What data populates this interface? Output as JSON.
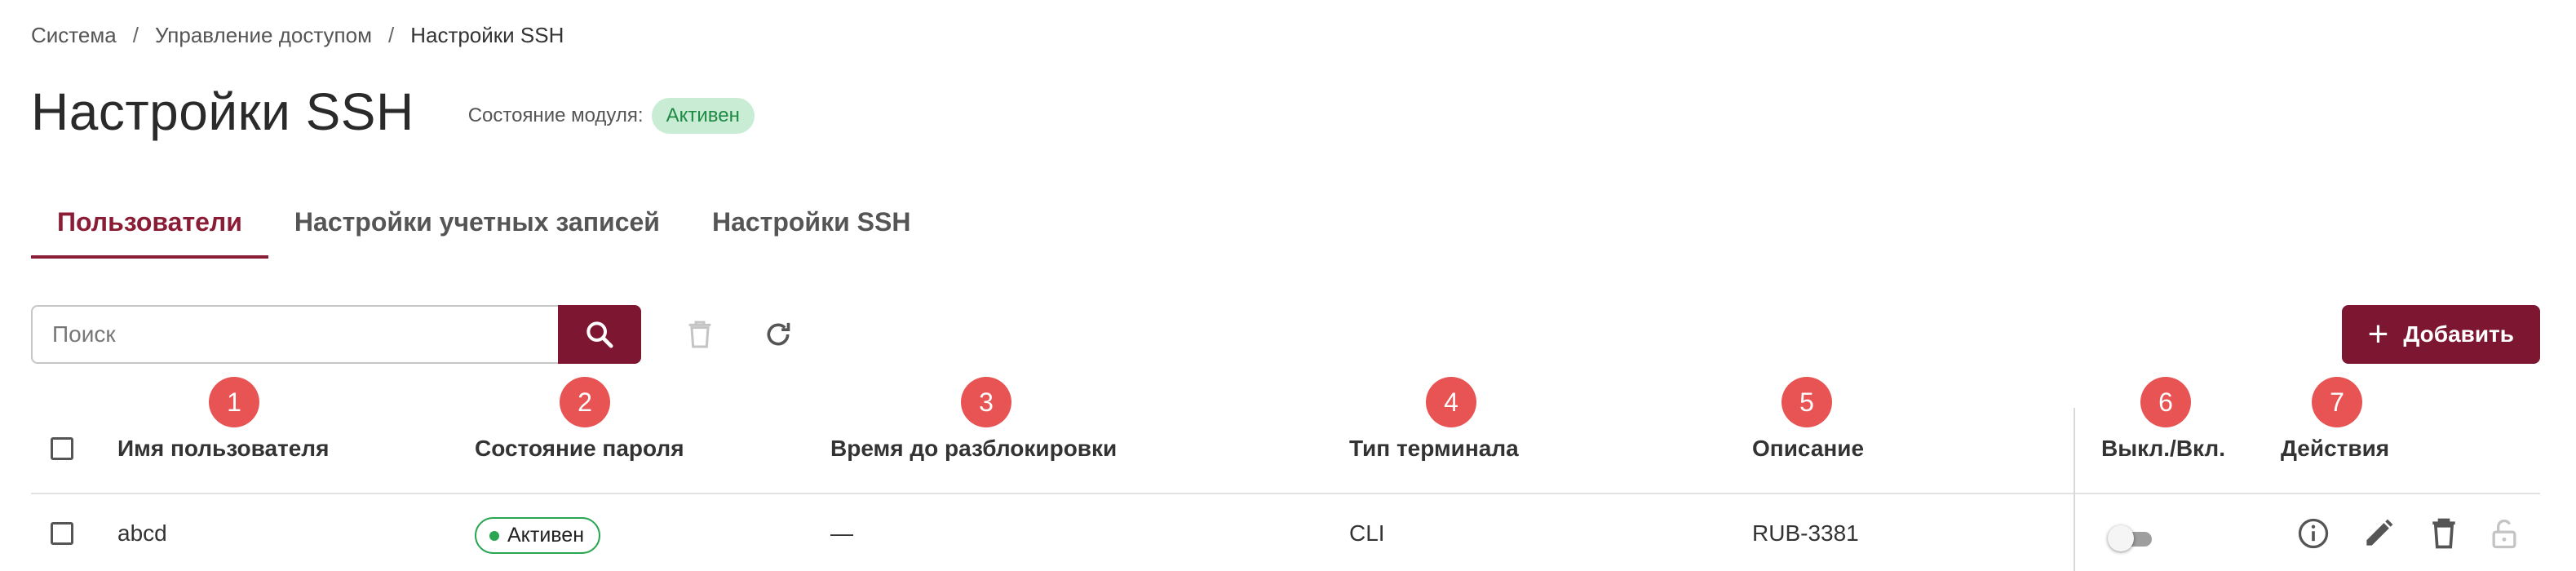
{
  "breadcrumb": {
    "items": [
      "Система",
      "Управление доступом",
      "Настройки SSH"
    ],
    "separator": "/"
  },
  "page": {
    "title": "Настройки SSH",
    "module_state_label": "Состояние модуля:",
    "module_state_value": "Активен"
  },
  "tabs": [
    {
      "label": "Пользователи",
      "active": true
    },
    {
      "label": "Настройки учетных записей",
      "active": false
    },
    {
      "label": "Настройки SSH",
      "active": false
    }
  ],
  "toolbar": {
    "search_placeholder": "Поиск",
    "search_icon": "search-icon",
    "delete_icon": "trash-icon",
    "refresh_icon": "refresh-icon",
    "add_label": "Добавить"
  },
  "markers": [
    "1",
    "2",
    "3",
    "4",
    "5",
    "6",
    "7"
  ],
  "table": {
    "columns": [
      "Имя пользователя",
      "Состояние пароля",
      "Время до разблокировки",
      "Тип терминала",
      "Описание",
      "Выкл./Вкл.",
      "Действия"
    ],
    "rows": [
      {
        "username": "abcd",
        "password_state": "Активен",
        "unlock_time": "—",
        "terminal_type": "CLI",
        "description": "RUB-3381",
        "enabled": false,
        "actions": [
          "info-icon",
          "edit-icon",
          "delete-icon",
          "unlock-icon"
        ]
      }
    ]
  },
  "colors": {
    "accent": "#7d1630",
    "tab_active": "#8a1c35",
    "marker": "#e85454",
    "badge_bg": "#c8ecd4",
    "badge_text": "#1f8a44",
    "status_green": "#2aa552"
  }
}
